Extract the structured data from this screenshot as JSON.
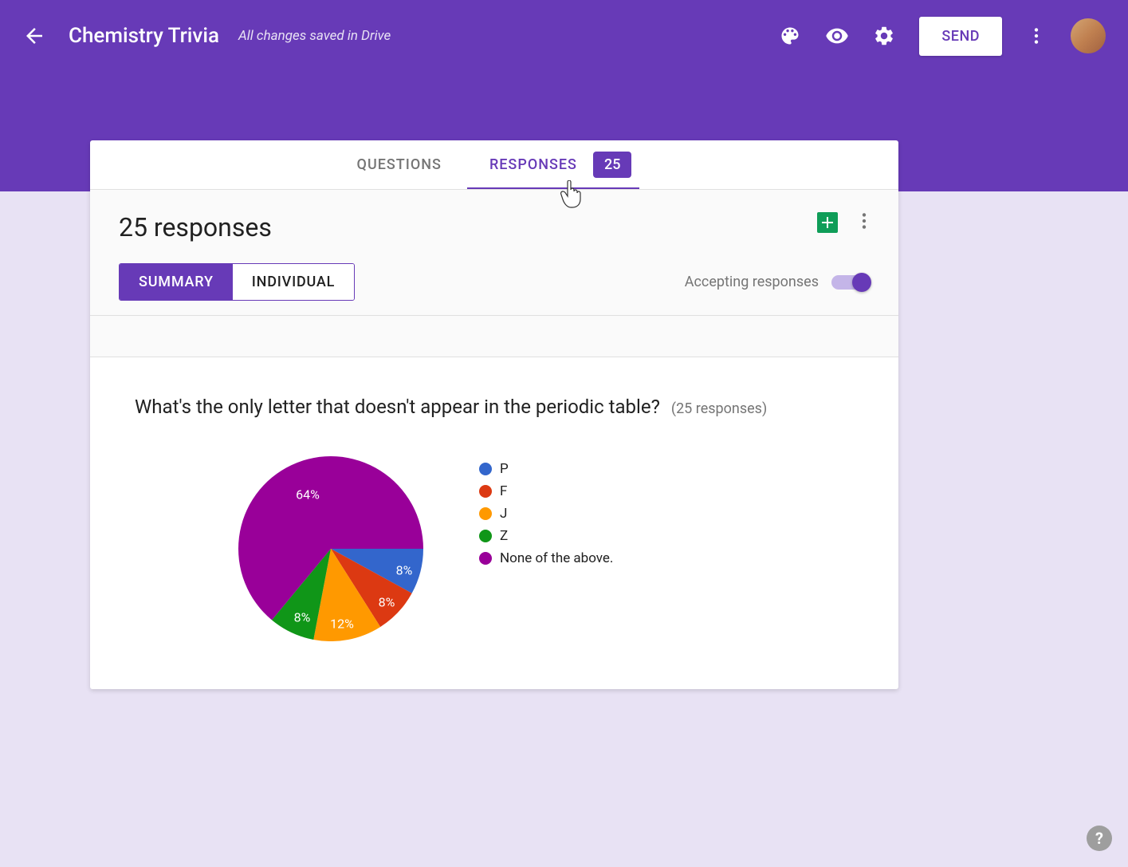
{
  "header": {
    "title": "Chemistry Trivia",
    "save_status": "All changes saved in Drive",
    "send_label": "SEND"
  },
  "tabs": {
    "questions": "QUESTIONS",
    "responses": "RESPONSES",
    "badge": "25"
  },
  "responses": {
    "count_label": "25 responses",
    "summary_label": "SUMMARY",
    "individual_label": "INDIVIDUAL",
    "accepting_label": "Accepting responses"
  },
  "question": {
    "text": "What's the only letter that doesn't appear in the periodic table?",
    "meta": "(25 responses)"
  },
  "legend": {
    "items": [
      {
        "label": "P",
        "color": "#3366cc"
      },
      {
        "label": "F",
        "color": "#dc3912"
      },
      {
        "label": "J",
        "color": "#ff9900"
      },
      {
        "label": "Z",
        "color": "#109618"
      },
      {
        "label": "None of the above.",
        "color": "#990099"
      }
    ]
  },
  "chart_data": {
    "type": "pie",
    "title": "What's the only letter that doesn't appear in the periodic table?",
    "categories": [
      "P",
      "F",
      "J",
      "Z",
      "None of the above."
    ],
    "values": [
      8,
      8,
      12,
      8,
      64
    ],
    "value_labels": [
      "8%",
      "8%",
      "12%",
      "8%",
      "64%"
    ],
    "colors": [
      "#3366cc",
      "#dc3912",
      "#ff9900",
      "#109618",
      "#990099"
    ],
    "total_responses": 25
  },
  "help": "?"
}
